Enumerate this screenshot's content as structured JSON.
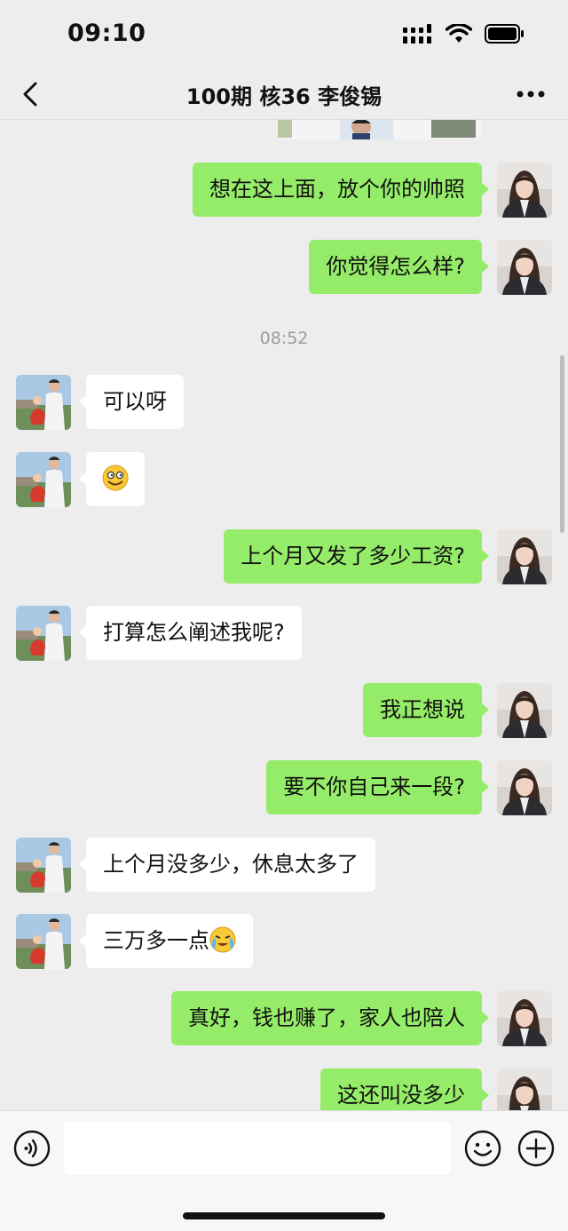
{
  "status_bar": {
    "time": "09:10"
  },
  "header": {
    "title": "100期 核36 李俊锡"
  },
  "timestamps": {
    "t1": "08:52"
  },
  "messages": {
    "m1": "想在这上面，放个你的帅照",
    "m2": "你觉得怎么样?",
    "m3": "可以呀",
    "m5": "上个月又发了多少工资?",
    "m6": "打算怎么阐述我呢?",
    "m7": "我正想说",
    "m8": "要不你自己来一段?",
    "m9": "上个月没多少，休息太多了",
    "m10": "三万多一点",
    "m11": "真好，钱也赚了，家人也陪人",
    "m12": "这还叫没多少"
  },
  "input": {
    "placeholder": ""
  }
}
